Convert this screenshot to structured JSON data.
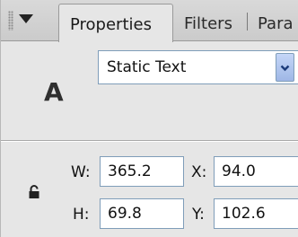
{
  "tabs": [
    {
      "label": "Properties",
      "active": true
    },
    {
      "label": "Filters"
    },
    {
      "label": "Para"
    }
  ],
  "object_type_glyph": "A",
  "text_type_select": {
    "selected": "Static Text"
  },
  "dimensions": {
    "width": {
      "label": "W:",
      "value": "365.2"
    },
    "height": {
      "label": "H:",
      "value": "69.8"
    },
    "x": {
      "label": "X:",
      "value": "94.0"
    },
    "y": {
      "label": "Y:",
      "value": "102.6"
    }
  },
  "icons": {
    "panel_menu": "triangle-down-icon",
    "dropdown": "chevron-down-icon",
    "lock": "lock-icon"
  },
  "colors": {
    "panel_bg": "#e6e6e6",
    "field_border": "#7f9db9",
    "dropdown_button": "#b3c8f0"
  }
}
